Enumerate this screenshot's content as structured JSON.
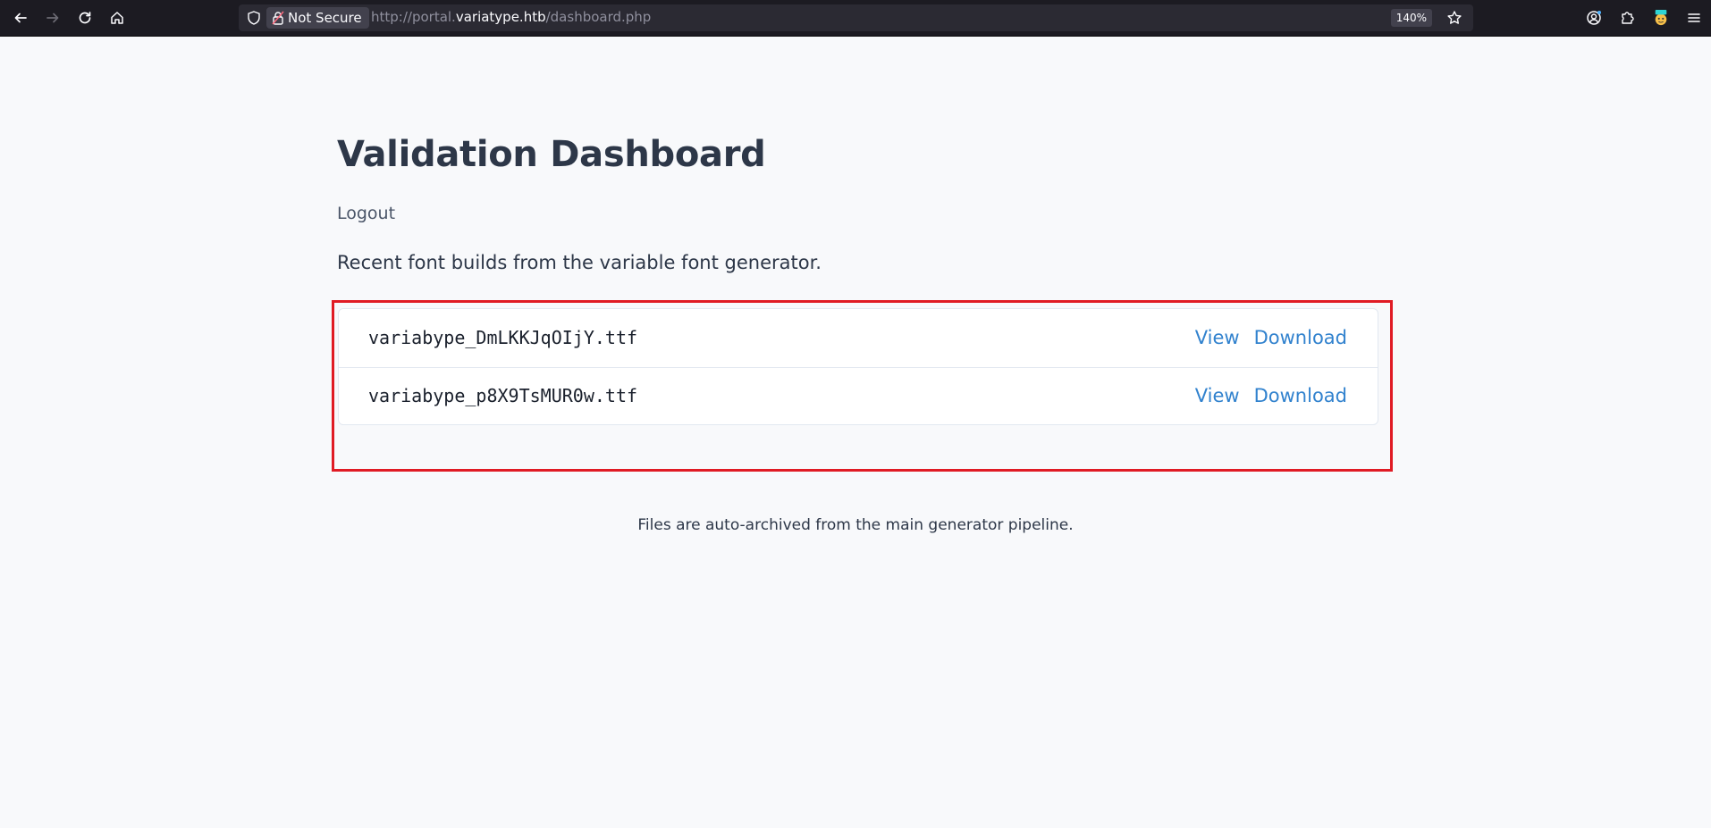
{
  "browser": {
    "security_label": "Not Secure",
    "url_prefix": "http://portal.",
    "url_domain": "variatype.htb",
    "url_path": "/dashboard.php",
    "zoom": "140%"
  },
  "page": {
    "title": "Validation Dashboard",
    "logout_label": "Logout",
    "intro": "Recent font builds from the variable font generator.",
    "files": [
      {
        "name": "variabype_DmLKKJqOIjY.ttf",
        "view_label": "View",
        "download_label": "Download"
      },
      {
        "name": "variabype_p8X9TsMUR0w.ttf",
        "view_label": "View",
        "download_label": "Download"
      }
    ],
    "footer": "Files are auto-archived from the main generator pipeline."
  },
  "colors": {
    "link": "#3182ce",
    "heading": "#2d3748",
    "highlight": "#e01b24"
  }
}
